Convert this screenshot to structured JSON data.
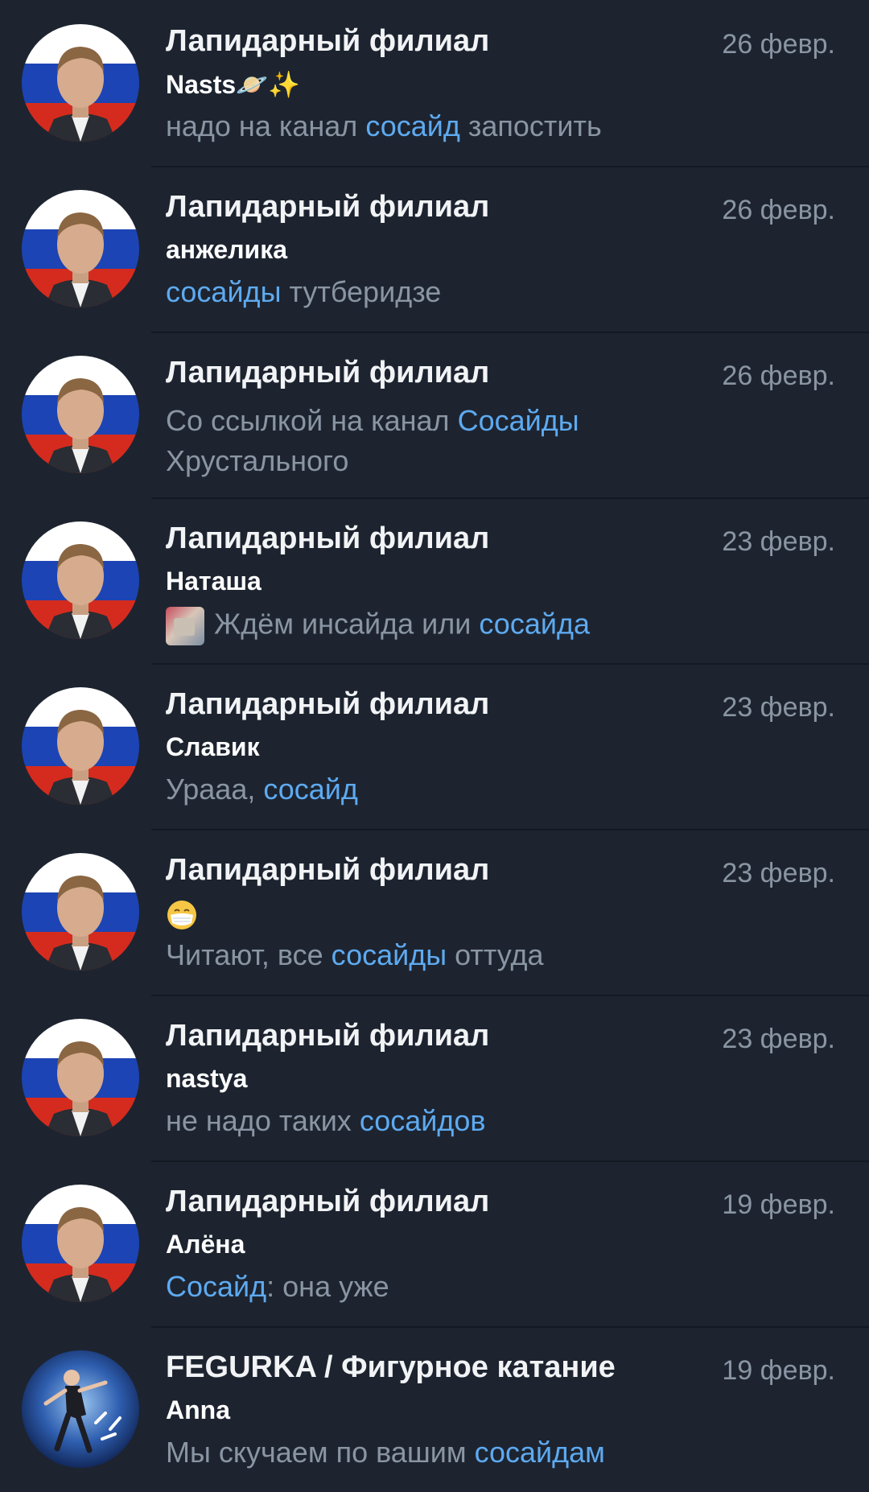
{
  "chats": [
    {
      "title": "Лапидарный филиал",
      "date": "26 февр.",
      "sender": "Nasts🪐✨",
      "preview": {
        "pre": "надо на канал ",
        "hl": "сосайд",
        "post": " запостить"
      }
    },
    {
      "title": "Лапидарный филиал",
      "date": "26 февр.",
      "sender": "анжелика",
      "preview": {
        "pre": "",
        "hl": "сосайды",
        "post": " тутберидзе"
      }
    },
    {
      "title": "Лапидарный филиал",
      "date": "26 февр.",
      "preview": {
        "pre": "Со ссылкой на канал ",
        "hl": "Сосайды",
        "post": " Хрустального"
      }
    },
    {
      "title": "Лапидарный филиал",
      "date": "23 февр.",
      "sender": "Наташа",
      "preview": {
        "pre": "Ждём инсайда или ",
        "hl": "сосайда",
        "post": ""
      }
    },
    {
      "title": "Лапидарный филиал",
      "date": "23 февр.",
      "sender": "Славик",
      "preview": {
        "pre": "Урааа, ",
        "hl": "сосайд",
        "post": ""
      }
    },
    {
      "title": "Лапидарный филиал",
      "date": "23 февр.",
      "preview": {
        "pre": "Читают, все ",
        "hl": "сосайды",
        "post": " оттуда"
      }
    },
    {
      "title": "Лапидарный филиал",
      "date": "23 февр.",
      "sender": "nastya",
      "preview": {
        "pre": "не надо таких ",
        "hl": "сосайдов",
        "post": ""
      }
    },
    {
      "title": "Лапидарный филиал",
      "date": "19 февр.",
      "sender": "Алёна",
      "preview": {
        "pre": "",
        "hl": "Сосайд",
        "post": ": она уже"
      }
    },
    {
      "title": "FEGURKA / Фигурное катание",
      "date": "19 февр.",
      "sender": "Anna",
      "preview": {
        "pre": "Мы скучаем по вашим ",
        "hl": "сосайдам",
        "post": ""
      }
    }
  ],
  "icons": {
    "avatar_flag": "flag-portrait-avatar",
    "avatar_skater": "figure-skater-avatar",
    "mask_emoji": "medical-mask-emoji",
    "photo_thumb": "photo-thumbnail"
  },
  "colors": {
    "background": "#1d2430",
    "highlight": "#5eaaf0",
    "muted": "#8a95a3"
  }
}
